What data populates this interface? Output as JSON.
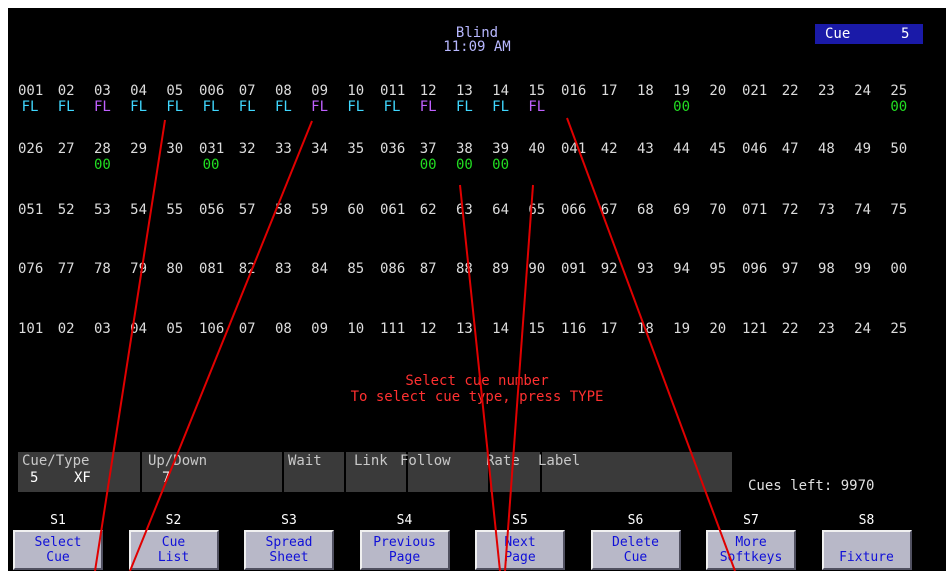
{
  "header": {
    "mode": "Blind",
    "time": "11:09 AM",
    "cue_label": "Cue",
    "cue_number": "5"
  },
  "channel_grid": {
    "rows": [
      [
        "001",
        "02",
        "03",
        "04",
        "05",
        "006",
        "07",
        "08",
        "09",
        "10",
        "011",
        "12",
        "13",
        "14",
        "15",
        "016",
        "17",
        "18",
        "19",
        "20",
        "021",
        "22",
        "23",
        "24",
        "25"
      ],
      [
        "026",
        "27",
        "28",
        "29",
        "30",
        "031",
        "32",
        "33",
        "34",
        "35",
        "036",
        "37",
        "38",
        "39",
        "40",
        "041",
        "42",
        "43",
        "44",
        "45",
        "046",
        "47",
        "48",
        "49",
        "50"
      ],
      [
        "051",
        "52",
        "53",
        "54",
        "55",
        "056",
        "57",
        "58",
        "59",
        "60",
        "061",
        "62",
        "63",
        "64",
        "65",
        "066",
        "67",
        "68",
        "69",
        "70",
        "071",
        "72",
        "73",
        "74",
        "75"
      ],
      [
        "076",
        "77",
        "78",
        "79",
        "80",
        "081",
        "82",
        "83",
        "84",
        "85",
        "086",
        "87",
        "88",
        "89",
        "90",
        "091",
        "92",
        "93",
        "94",
        "95",
        "096",
        "97",
        "98",
        "99",
        "00"
      ],
      [
        "101",
        "02",
        "03",
        "04",
        "05",
        "106",
        "07",
        "08",
        "09",
        "10",
        "111",
        "12",
        "13",
        "14",
        "15",
        "116",
        "17",
        "18",
        "19",
        "20",
        "121",
        "22",
        "23",
        "24",
        "25"
      ]
    ],
    "levels": [
      [
        {
          "col": 0,
          "text": "FL",
          "color": "#40d8ff"
        },
        {
          "col": 1,
          "text": "FL",
          "color": "#40d8ff"
        },
        {
          "col": 2,
          "text": "FL",
          "color": "#c060ff"
        },
        {
          "col": 3,
          "text": "FL",
          "color": "#40d8ff"
        },
        {
          "col": 4,
          "text": "FL",
          "color": "#40d8ff"
        },
        {
          "col": 5,
          "text": "FL",
          "color": "#40d8ff"
        },
        {
          "col": 6,
          "text": "FL",
          "color": "#40d8ff"
        },
        {
          "col": 7,
          "text": "FL",
          "color": "#40d8ff"
        },
        {
          "col": 8,
          "text": "FL",
          "color": "#c060ff"
        },
        {
          "col": 9,
          "text": "FL",
          "color": "#40d8ff"
        },
        {
          "col": 10,
          "text": "FL",
          "color": "#40d8ff"
        },
        {
          "col": 11,
          "text": "FL",
          "color": "#c060ff"
        },
        {
          "col": 12,
          "text": "FL",
          "color": "#40d8ff"
        },
        {
          "col": 13,
          "text": "FL",
          "color": "#40d8ff"
        },
        {
          "col": 14,
          "text": "FL",
          "color": "#c060ff"
        },
        {
          "col": 18,
          "text": "00",
          "color": "#22dd22"
        },
        {
          "col": 24,
          "text": "00",
          "color": "#22dd22"
        }
      ],
      [
        {
          "col": 2,
          "text": "00",
          "color": "#22dd22"
        },
        {
          "col": 5,
          "text": "00",
          "color": "#22dd22"
        },
        {
          "col": 11,
          "text": "00",
          "color": "#22dd22"
        },
        {
          "col": 12,
          "text": "00",
          "color": "#22dd22"
        },
        {
          "col": 13,
          "text": "00",
          "color": "#22dd22"
        }
      ],
      [],
      [],
      []
    ]
  },
  "prompt": {
    "line1": "Select cue number",
    "line2": "To select cue type, press TYPE"
  },
  "fields": {
    "cue_type_label": "Cue/Type",
    "cue_value": "5",
    "type_value": "XF",
    "updown_label": "Up/Down",
    "updown_value": "7",
    "wait_label": "Wait",
    "link_label": "Link",
    "follow_label": "Follow",
    "rate_label": "Rate",
    "label_label": "Label",
    "cues_left": "Cues left: 9970"
  },
  "softkeys": [
    {
      "num": "S1",
      "line1": "Select",
      "line2": "Cue"
    },
    {
      "num": "S2",
      "line1": "Cue",
      "line2": "List"
    },
    {
      "num": "S3",
      "line1": "Spread",
      "line2": "Sheet"
    },
    {
      "num": "S4",
      "line1": "Previous",
      "line2": "Page"
    },
    {
      "num": "S5",
      "line1": "Next",
      "line2": "Page"
    },
    {
      "num": "S6",
      "line1": "Delete",
      "line2": "Cue"
    },
    {
      "num": "S7",
      "line1": "More",
      "line2": "Softkeys"
    },
    {
      "num": "S8",
      "line1": "",
      "line2": "Fixture"
    }
  ],
  "annotation_color": "#e00000"
}
